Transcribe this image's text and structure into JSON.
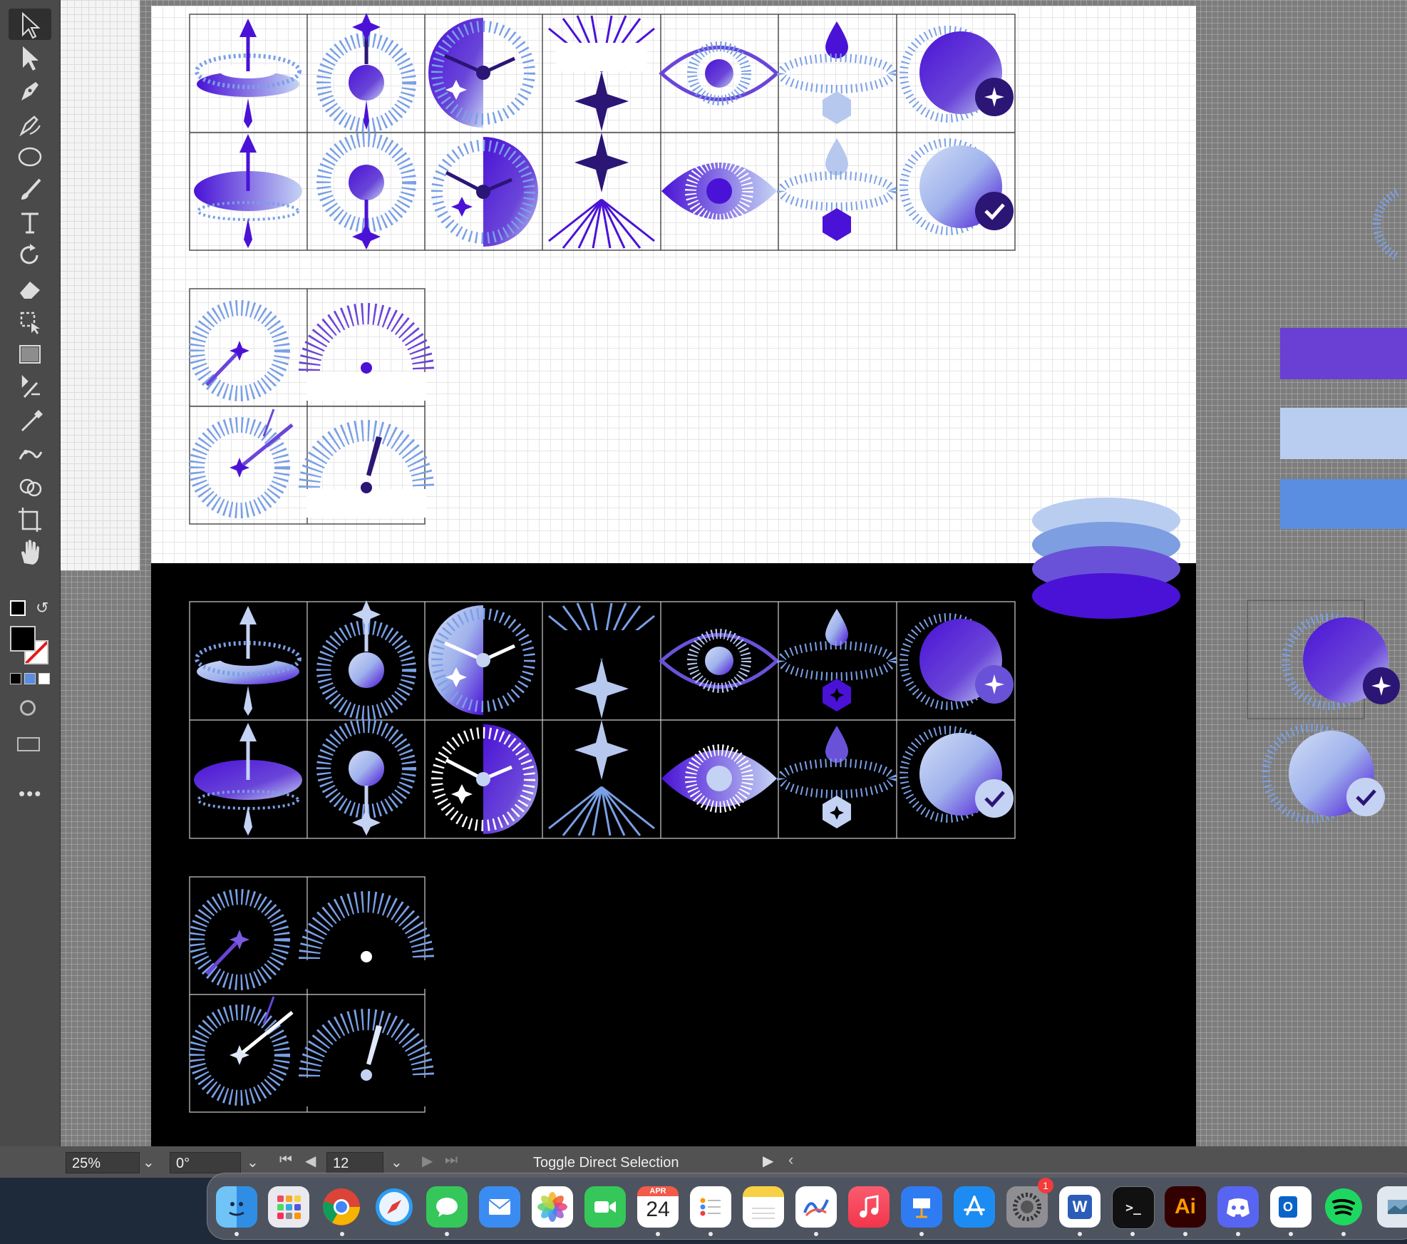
{
  "status": {
    "zoom": "25%",
    "rotation": "0°",
    "artboard": "12",
    "message": "Toggle Direct Selection"
  },
  "tools": [
    {
      "name": "selection-tool",
      "icon": "selection-arrow-icon"
    },
    {
      "name": "direct-selection-tool",
      "icon": "direct-selection-icon"
    },
    {
      "name": "pen-tool",
      "icon": "pen-icon"
    },
    {
      "name": "curvature-tool",
      "icon": "curvature-pen-icon"
    },
    {
      "name": "ellipse-tool",
      "icon": "ellipse-icon"
    },
    {
      "name": "paintbrush-tool",
      "icon": "paintbrush-icon"
    },
    {
      "name": "type-tool",
      "icon": "type-icon"
    },
    {
      "name": "rotate-tool",
      "icon": "rotate-icon"
    },
    {
      "name": "eraser-tool",
      "icon": "eraser-icon"
    },
    {
      "name": "free-transform-tool",
      "icon": "free-transform-icon"
    },
    {
      "name": "gradient-tool",
      "icon": "gradient-icon"
    },
    {
      "name": "blend-tool",
      "icon": "blend-icon"
    },
    {
      "name": "eyedropper-tool",
      "icon": "eyedropper-icon"
    },
    {
      "name": "puppet-warp-tool",
      "icon": "puppet-warp-icon"
    },
    {
      "name": "shape-builder-tool",
      "icon": "shape-builder-icon"
    },
    {
      "name": "artboard-tool",
      "icon": "artboard-icon"
    },
    {
      "name": "hand-tool",
      "icon": "hand-icon"
    }
  ],
  "dock": {
    "calendar_month": "APR",
    "calendar_day": "24",
    "settings_badge": "1",
    "illustrator_label": "Ai",
    "word_label": "W",
    "outlook_label": "O",
    "apps": [
      "finder",
      "launchpad",
      "chrome",
      "safari",
      "messages",
      "mail",
      "photos",
      "facetime",
      "calendar",
      "reminders",
      "notes",
      "freeform",
      "music",
      "keynote",
      "app-store",
      "system-settings",
      "word",
      "terminal",
      "illustrator",
      "discord",
      "outlook",
      "spotify",
      "preview"
    ]
  },
  "colors": {
    "deep_violet": "#4a12d6",
    "navy_violet": "#2b1575",
    "light_periwinkle": "#b7c8ef",
    "sky_blue": "#5b8ee0",
    "swatch_violet": "#6a3fd4",
    "swatch_light": "#b9cdf0",
    "swatch_blue": "#5a8ee0"
  }
}
